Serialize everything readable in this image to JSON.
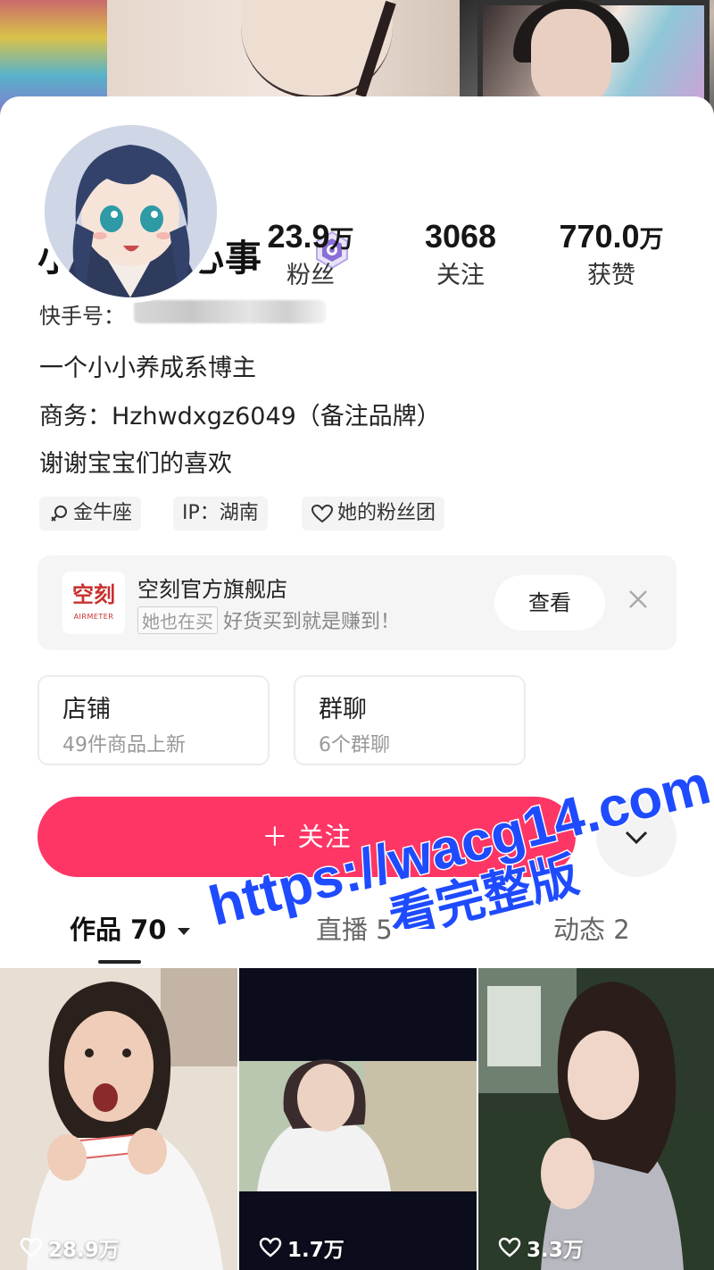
{
  "profile": {
    "nickname": "小狗的烦心事",
    "id_label": "快手号：",
    "bio": [
      "一个小小养成系博主",
      "商务：Hzhwdxgz6049（备注品牌）",
      "谢谢宝宝们的喜欢"
    ]
  },
  "stats": [
    {
      "value": "23.9",
      "unit": "万",
      "label": "粉丝"
    },
    {
      "value": "3068",
      "unit": "",
      "label": "关注"
    },
    {
      "value": "770.0",
      "unit": "万",
      "label": "获赞"
    }
  ],
  "tags": [
    {
      "icon": "zodiac-icon",
      "label": "金牛座"
    },
    {
      "icon": "",
      "label": "IP：湖南"
    },
    {
      "icon": "heart-icon",
      "label": "她的粉丝团"
    }
  ],
  "shop_banner": {
    "logo_cn": "空刻",
    "logo_en": "AIRMETER",
    "name": "空刻官方旗舰店",
    "chip": "她也在买",
    "slogan": "好货买到就是赚到！",
    "view_label": "查看"
  },
  "cards": [
    {
      "title": "店铺",
      "sub": "49件商品上新"
    },
    {
      "title": "群聊",
      "sub": "6个群聊"
    }
  ],
  "follow_label": "＋ 关注",
  "tabs": [
    {
      "label": "作品 70"
    },
    {
      "label": "直播 5"
    },
    {
      "label": "动态 2"
    }
  ],
  "posts": [
    {
      "likes": "28.9万"
    },
    {
      "likes": "1.7万"
    },
    {
      "likes": "3.3万"
    }
  ],
  "watermark": {
    "line1": "https://wacg14.com",
    "line2": "看完整版"
  },
  "colors": {
    "accent": "#fe3666",
    "watermark": "#1f4bff"
  }
}
